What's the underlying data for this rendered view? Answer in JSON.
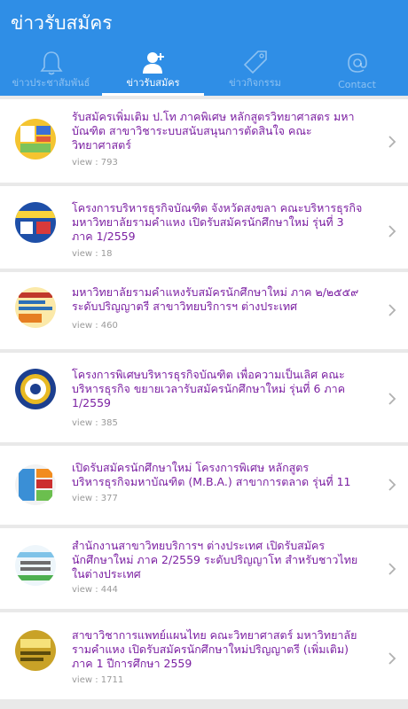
{
  "app": {
    "title": "ข่าวรับสมัคร"
  },
  "tabs": [
    {
      "label": "ข่าวประชาสัมพันธ์",
      "icon": "bell-icon"
    },
    {
      "label": "ข่าวรับสมัคร",
      "icon": "add-user-icon"
    },
    {
      "label": "ข่าวกิจกรรม",
      "icon": "tag-icon"
    },
    {
      "label": "Contact",
      "icon": "at-icon"
    }
  ],
  "news": [
    {
      "title": "รับสมัครเพิ่มเติม ป.โท ภาคพิเศษ หลักสูตรวิทยาศาสตร มหาบัณฑิต สาขาวิชาระบบสนับสนุนการตัดสินใจ คณะวิทยาศาสตร์",
      "views": "view : 793"
    },
    {
      "title": "โครงการบริหารธุรกิจบัณฑิต จังหวัดสงขลา คณะบริหารธุรกิจ มหาวิทยาลัยรามคำแหง เปิดรับสมัครนักศึกษาใหม่ รุ่นที่ 3 ภาค 1/2559",
      "views": "view : 18"
    },
    {
      "title": "มหาวิทยาลัยรามคำแหงรับสมัครนักศึกษาใหม่ ภาค ๒/๒๕๕๙ ระดับปริญญาตรี สาขาวิทยบริการฯ ต่างประเทศ",
      "views": "view : 460"
    },
    {
      "title": "โครงการพิเศษบริหารธุรกิจบัณฑิต เพื่อความเป็นเลิศ คณะบริหารธุรกิจ ขยายเวลารับสมัครนักศึกษาใหม่ รุ่นที่ 6 ภาค 1/2559",
      "views": "view : 385"
    },
    {
      "title": "เปิดรับสมัครนักศึกษาใหม่ โครงการพิเศษ หลักสูตรบริหารธุรกิจมหาบัณฑิต (M.B.A.) สาขาการตลาด รุ่นที่ 11",
      "views": "view : 377"
    },
    {
      "title": "สำนักงานสาขาวิทยบริการฯ ต่างประเทศ เปิดรับสมัครนักศึกษาใหม่ ภาค 2/2559 ระดับปริญญาโท สำหรับชาวไทยในต่างประเทศ",
      "views": "view : 444"
    },
    {
      "title": "สาขาวิชาการแพทย์แผนไทย คณะวิทยาศาสตร์ มหาวิทยาลัยรามคำแหง เปิดรับสมัครนักศึกษาใหม่ปริญญาตรี (เพิ่มเติม) ภาค 1 ปีการศึกษา 2559",
      "views": "view : 1711"
    }
  ],
  "colors": {
    "appbar": "#2f8ee6",
    "title": "#7b1fa2",
    "background": "#e9e9e9"
  }
}
